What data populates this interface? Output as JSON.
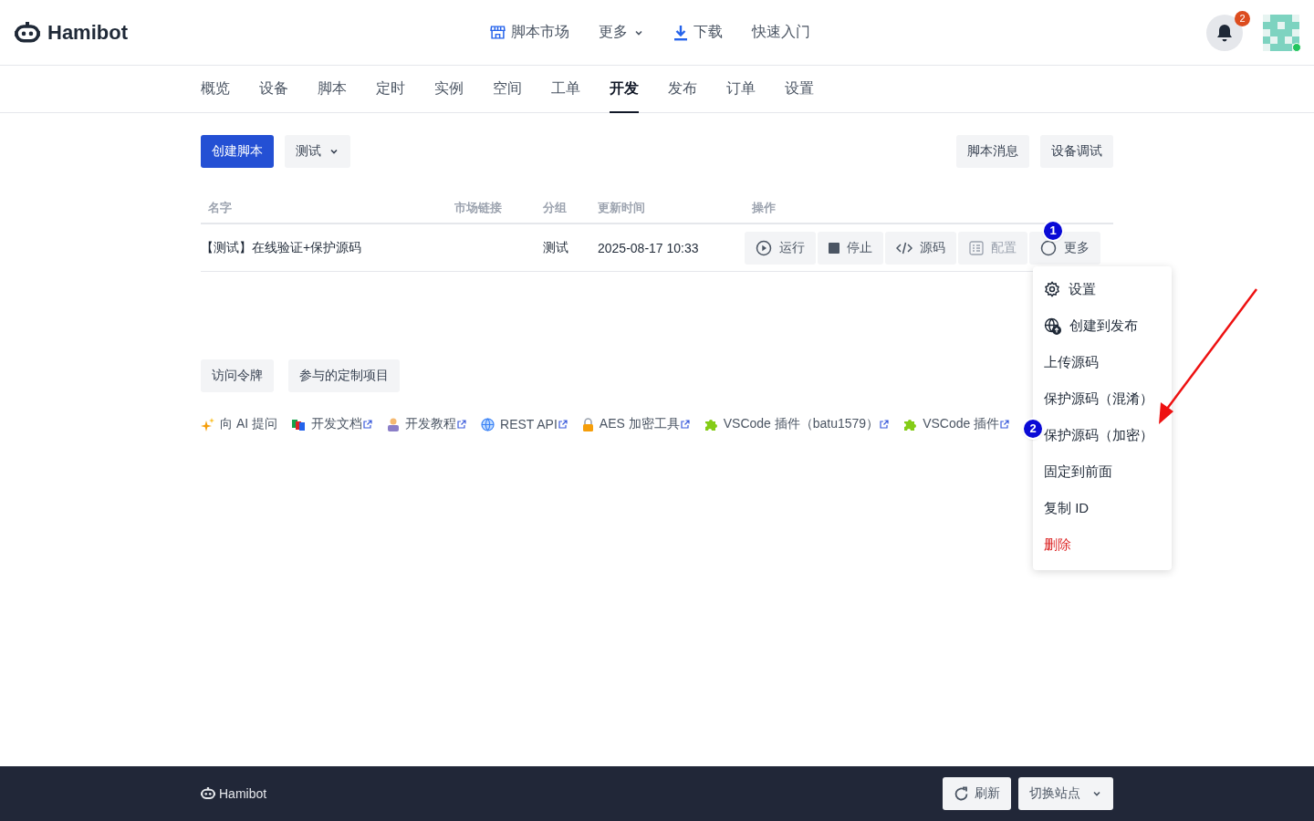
{
  "header": {
    "logo": "Hamibot",
    "nav": [
      {
        "label": "脚本市场"
      },
      {
        "label": "更多"
      },
      {
        "label": "下载"
      },
      {
        "label": "快速入门"
      }
    ],
    "notification_count": "2",
    "online": true
  },
  "tabs": [
    {
      "label": "概览",
      "selected": false
    },
    {
      "label": "设备",
      "selected": false
    },
    {
      "label": "脚本",
      "selected": false
    },
    {
      "label": "定时",
      "selected": false
    },
    {
      "label": "实例",
      "selected": false
    },
    {
      "label": "空间",
      "selected": false
    },
    {
      "label": "工单",
      "selected": false
    },
    {
      "label": "开发",
      "selected": true
    },
    {
      "label": "发布",
      "selected": false
    },
    {
      "label": "订单",
      "selected": false
    },
    {
      "label": "设置",
      "selected": false
    }
  ],
  "toolbar": {
    "primary": "创建脚本",
    "filter": "测试",
    "right": [
      "脚本消息",
      "设备调试"
    ]
  },
  "table": {
    "columns": [
      "名字",
      "市场链接",
      "分组",
      "更新时间",
      "操作"
    ],
    "rows": [
      {
        "name": "【测试】在线验证+保护源码",
        "group": "测试",
        "updated": "2025-08-17 10:33",
        "actions": [
          {
            "label": "运行",
            "disabled": false
          },
          {
            "label": "停止",
            "disabled": false
          },
          {
            "label": "源码",
            "disabled": false
          },
          {
            "label": "配置",
            "disabled": true
          },
          {
            "label": "更多",
            "disabled": false
          }
        ]
      }
    ]
  },
  "extra_buttons": [
    "访问令牌",
    "参与的定制项目"
  ],
  "links": [
    {
      "label": "向 AI 提问",
      "external": false
    },
    {
      "label": "开发文档",
      "external": true
    },
    {
      "label": "开发教程",
      "external": true
    },
    {
      "label": "REST API",
      "external": true
    },
    {
      "label": "AES 加密工具",
      "external": true
    },
    {
      "label": "VSCode 插件（batu1579）",
      "external": true
    },
    {
      "label": "VSCode 插件",
      "external": true
    }
  ],
  "menu": {
    "items": [
      {
        "label": "设置",
        "kind": "normal"
      },
      {
        "label": "创建到发布",
        "kind": "normal"
      },
      {
        "label": "上传源码",
        "kind": "normal"
      },
      {
        "label": "保护源码（混淆）",
        "kind": "normal"
      },
      {
        "label": "保护源码（加密）",
        "kind": "normal"
      },
      {
        "label": "固定到前面",
        "kind": "normal"
      },
      {
        "label": "复制 ID",
        "kind": "normal"
      },
      {
        "label": "删除",
        "kind": "danger"
      }
    ]
  },
  "annotations": {
    "markers": [
      "1",
      "2"
    ]
  },
  "footer": {
    "logo": "Hamibot",
    "buttons": [
      {
        "label": "刷新"
      },
      {
        "label": "切换站点"
      }
    ]
  }
}
